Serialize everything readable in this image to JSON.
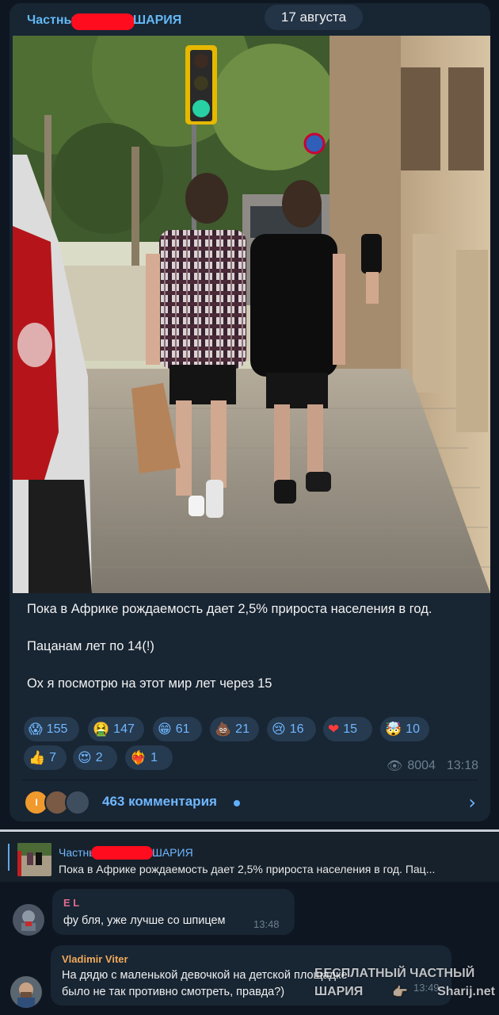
{
  "post": {
    "channel_name_start": "Частны",
    "channel_name_end": "ШАРИЯ",
    "date": "17 августа",
    "caption_line1": "Пока в Африке рождаемость дает 2,5% прироста населения в год.",
    "caption_line2": "Пацанам лет по 14(!)",
    "caption_line3": "Ох я посмотрю на этот мир лет через 15",
    "reactions": [
      {
        "emoji": "😱",
        "count": "155"
      },
      {
        "emoji": "🤮",
        "count": "147"
      },
      {
        "emoji": "😁",
        "count": "61"
      },
      {
        "emoji": "💩",
        "count": "21"
      },
      {
        "emoji": "😢",
        "count": "16"
      },
      {
        "emoji": "❤",
        "count": "15"
      },
      {
        "emoji": "🤯",
        "count": "10"
      },
      {
        "emoji": "👍",
        "count": "7"
      },
      {
        "emoji": "😍",
        "count": "2"
      },
      {
        "emoji": "❤‍🔥",
        "count": "1"
      }
    ],
    "views": "8004",
    "time": "13:18",
    "comments_label": "463 комментария",
    "avatar_initial": "I",
    "eye_icon": "👁",
    "chevron": "›"
  },
  "pinned": {
    "title_start": "Частны",
    "title_end": "ШАРИЯ",
    "text": "Пока в Африке рождаемость дает 2,5% прироста населения в год.   Пац..."
  },
  "messages": [
    {
      "author": "E L",
      "text": "фу бля, уже лучше со шпицем",
      "time": "13:48",
      "name_color": "#e06c8e"
    },
    {
      "author": "Vladimir Viter",
      "text_line1": "На дядю с маленькой девочкой на детской площадке",
      "text_line2": "было не так противно смотреть, правда?)",
      "time": "13:49",
      "name_color": "#f0a95a"
    }
  ],
  "watermark": {
    "line1": "БЕСПЛАТНЫЙ ЧАСТНЫЙ",
    "line2a": "ШАРИЯ",
    "line2b": "👉🏻",
    "line2c": "Sharij.net"
  },
  "colors": {
    "background": "#0e1621",
    "card": "#182533",
    "accent": "#6fb7ff",
    "redaction": "#ff0d1f"
  }
}
